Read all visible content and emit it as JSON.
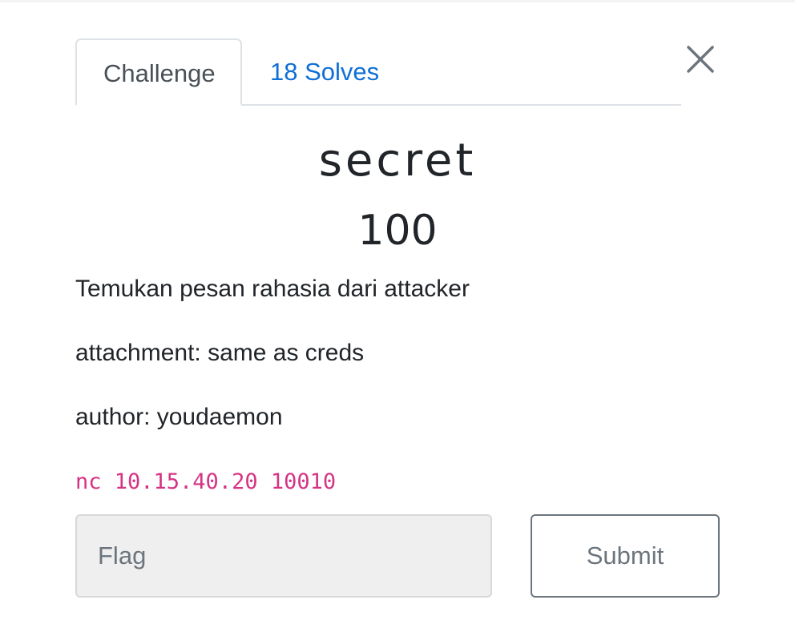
{
  "tabs": [
    {
      "label": "Challenge",
      "active": true
    },
    {
      "label": "18 Solves",
      "active": false
    }
  ],
  "challenge": {
    "name": "secret",
    "points": "100",
    "description": [
      "Temukan pesan rahasia dari attacker",
      "attachment: same as creds",
      "author: youdaemon"
    ],
    "connection": "nc 10.15.40.20 10010"
  },
  "form": {
    "flag_placeholder": "Flag",
    "flag_value": "",
    "submit_label": "Submit"
  },
  "icons": {
    "close": "close-icon"
  },
  "colors": {
    "link": "#0f6fd6",
    "code": "#d63384",
    "muted": "#6c757d",
    "input_bg": "#efefef"
  }
}
